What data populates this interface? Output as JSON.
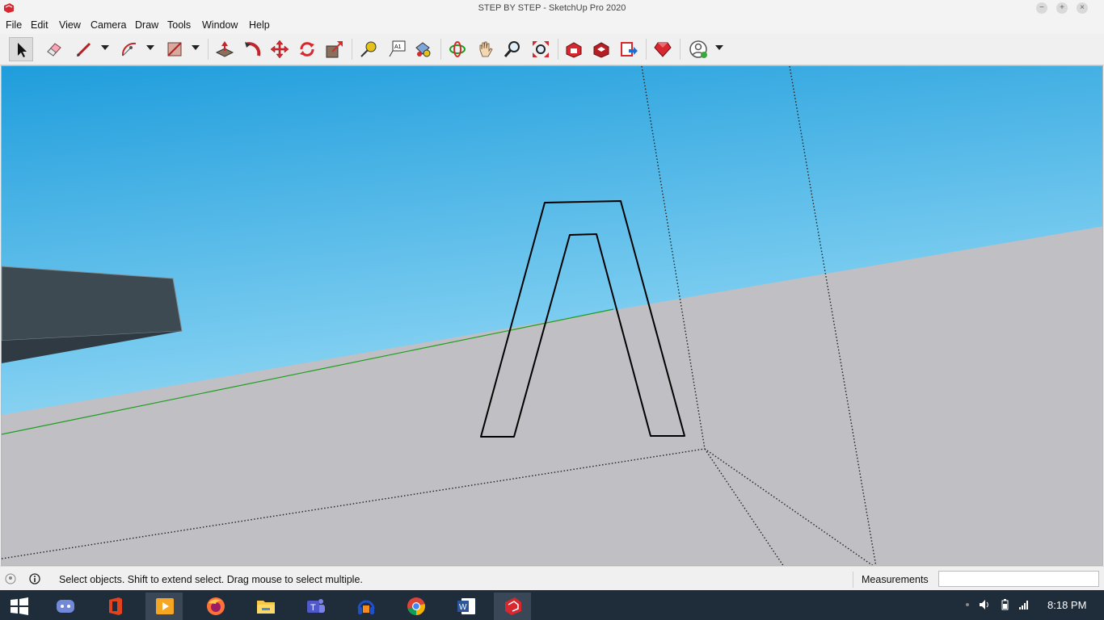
{
  "window": {
    "title": "STEP BY STEP - SketchUp Pro 2020",
    "minimize": "−",
    "maximize": "+",
    "close": "×"
  },
  "menu": [
    "File",
    "Edit",
    "View",
    "Camera",
    "Draw",
    "Tools",
    "Window",
    "Help"
  ],
  "toolbar": {
    "tools": [
      "select",
      "eraser",
      "pencil-line",
      "arc",
      "rectangle",
      "push-pull",
      "follow-me",
      "move",
      "rotate",
      "scale",
      "tape-measure",
      "text",
      "paint-bucket",
      "orbit",
      "pan",
      "zoom",
      "zoom-extents",
      "3d-warehouse",
      "extension-warehouse",
      "send-to-layout",
      "extension-manager",
      "account"
    ],
    "text_tool_label": "A1"
  },
  "colors": {
    "sky_top": "#1f9ddc",
    "sky_bottom": "#c6e7f6",
    "ground": "#bfbfc4",
    "green_axis": "#1e9e1e",
    "dark_face": "#3e4a52",
    "accent_red": "#d7282f"
  },
  "status": {
    "hint": "Select objects. Shift to extend select. Drag mouse to select multiple.",
    "measurements_label": "Measurements",
    "measurements_value": ""
  },
  "taskbar": {
    "apps": [
      "start",
      "discord",
      "office",
      "media-player",
      "firefox",
      "file-explorer",
      "teams",
      "audacity",
      "chrome",
      "word",
      "sketchup"
    ],
    "clock": "8:18 PM"
  }
}
